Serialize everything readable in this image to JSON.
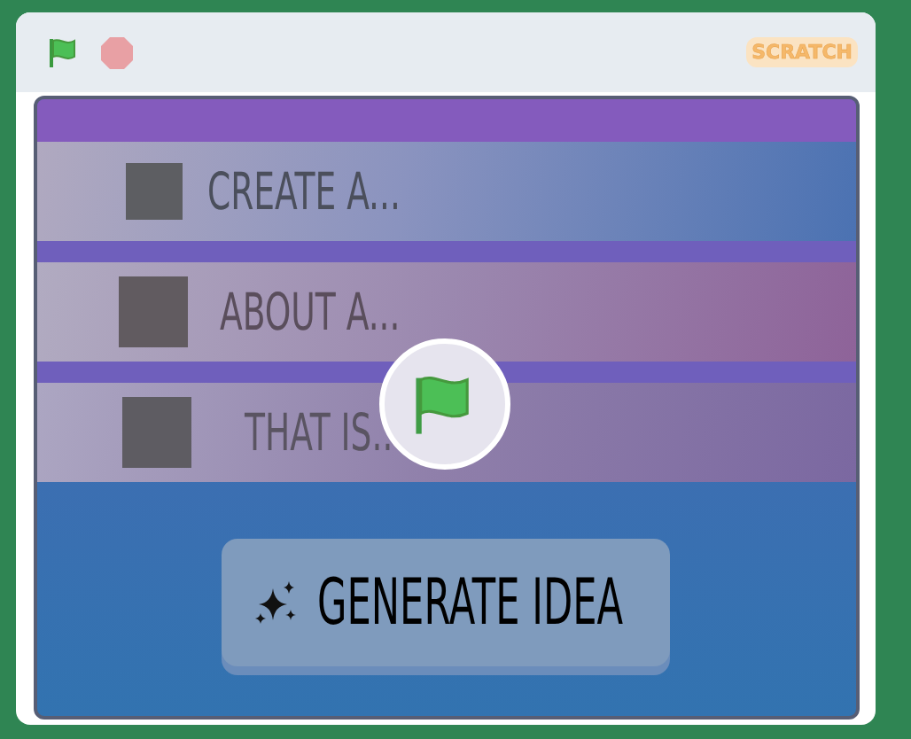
{
  "player": {
    "logo": "SCRATCH"
  },
  "stage": {
    "rows": [
      {
        "label": "CREATE A..."
      },
      {
        "label": "ABOUT A..."
      },
      {
        "label": "THAT IS.."
      }
    ],
    "button": {
      "label": "GENERATE IDEA"
    }
  }
}
